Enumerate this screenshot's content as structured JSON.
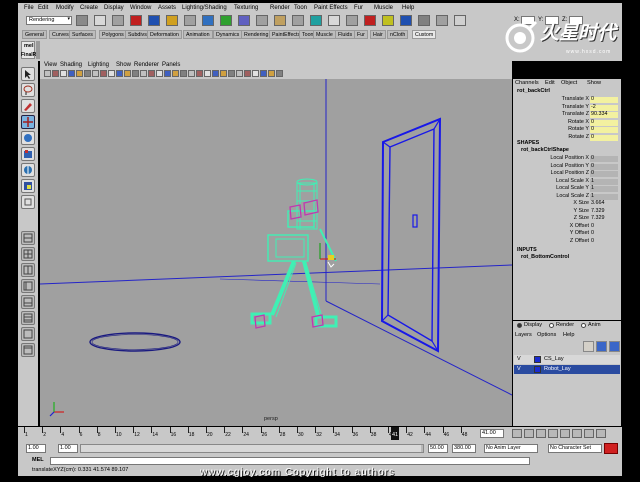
{
  "menu": [
    "File",
    "Edit",
    "Modify",
    "Create",
    "Display",
    "Window",
    "Assets",
    "Lighting/Shading",
    "Texturing",
    "Render",
    "Toon",
    "Paint Effects",
    "Fur",
    "Muscle",
    "Help"
  ],
  "status": {
    "mode": "Rendering",
    "coord_x_label": "X:",
    "coord_y_label": "Y:",
    "coord_z_label": "Z:"
  },
  "shelf_tabs": [
    "General",
    "Curves",
    "Surfaces",
    "Polygons",
    "Subdivs",
    "Deformation",
    "Animation",
    "Dynamics",
    "Rendering",
    "PaintEffects",
    "Toon",
    "Muscle",
    "Fluids",
    "Fur",
    "Hair",
    "nCloth",
    "Custom"
  ],
  "shelf_items": [
    "mel",
    "FinalR"
  ],
  "panel_menu": [
    "View",
    "Shading",
    "Lighting",
    "Show",
    "Renderer",
    "Panels"
  ],
  "viewport": {
    "axis_label": "persp"
  },
  "channel_box": {
    "menu": [
      "Channels",
      "Edit",
      "Object",
      "Show"
    ],
    "object_name": "rot_backCtrl",
    "attributes": [
      {
        "label": "Translate X",
        "value": "0"
      },
      {
        "label": "Translate Y",
        "value": "-2"
      },
      {
        "label": "Translate Z",
        "value": "90.334"
      },
      {
        "label": "Rotate X",
        "value": "0"
      },
      {
        "label": "Rotate Y",
        "value": "0"
      },
      {
        "label": "Rotate Z",
        "value": "0"
      }
    ],
    "shapes_header": "SHAPES",
    "shape_name": "rot_backCtrlShape",
    "shape_attributes": [
      {
        "label": "Local Position X",
        "value": "0"
      },
      {
        "label": "Local Position Y",
        "value": "0"
      },
      {
        "label": "Local Position Z",
        "value": "0"
      },
      {
        "label": "Local Scale X",
        "value": "1"
      },
      {
        "label": "Local Scale Y",
        "value": "1"
      },
      {
        "label": "Local Scale Z",
        "value": "1"
      },
      {
        "label": "X Size",
        "value": "3.664"
      },
      {
        "label": "Y Size",
        "value": "7.329"
      },
      {
        "label": "Z Size",
        "value": "7.329"
      },
      {
        "label": "X Offset",
        "value": "0"
      },
      {
        "label": "Y Offset",
        "value": "0"
      },
      {
        "label": "Z Offset",
        "value": "0"
      }
    ],
    "inputs_header": "INPUTS",
    "input_name": "rot_BottomControl"
  },
  "layer_editor": {
    "radio": [
      "Display",
      "Render",
      "Anim"
    ],
    "menu": [
      "Layers",
      "Options",
      "Help"
    ],
    "layers": [
      {
        "visible": "V",
        "name": "CS_Lay",
        "color": "#1a2bd0"
      },
      {
        "visible": "V",
        "name": "Robot_Lay",
        "color": "#1a2bd0"
      }
    ]
  },
  "time_slider": {
    "ticks": [
      "1",
      "2",
      "4",
      "6",
      "8",
      "10",
      "12",
      "14",
      "16",
      "18",
      "20",
      "22",
      "24",
      "26",
      "28",
      "30",
      "32",
      "34",
      "36",
      "38",
      "40",
      "42",
      "44",
      "46",
      "48"
    ],
    "current_frame": "41",
    "current_frame_field": "41.00"
  },
  "range": {
    "start": "1.00",
    "inner_start": "1.00",
    "inner_end": "50.00",
    "end": "380.00",
    "anim_layer": "No Anim Layer",
    "char_set": "No Character Set"
  },
  "command_line": {
    "label": "MEL",
    "value": ""
  },
  "help_line": {
    "text": "translateXYZ(cm):  0.331        41.574    89.107"
  },
  "watermark": {
    "logo_text": "火星时代",
    "site_top": "www.hxsd.com",
    "footer": "www.cgjoy.com   Copyright to authors"
  },
  "colors": {
    "ui_gray": "#c8c8c8",
    "viewport_gray": "#a0a0a0",
    "robot_green": "#3ff0b4",
    "door_blue": "#1a1ae0",
    "highlight_yellow": "#f3f1a0",
    "selection_blue": "#2a4ba0"
  }
}
